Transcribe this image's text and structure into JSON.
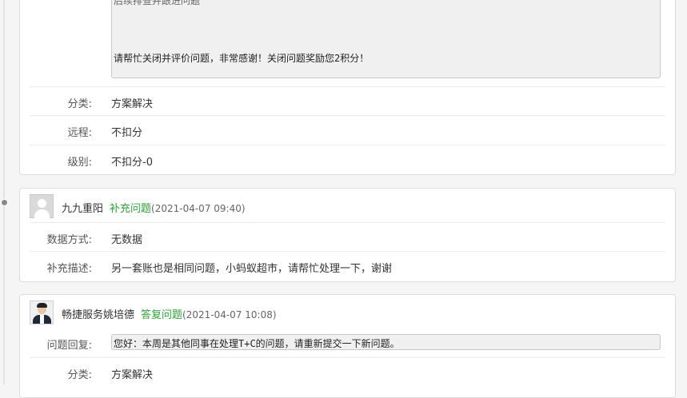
{
  "entry1": {
    "quote_line1": "后续排查并跟进问题",
    "quote_line2": "请帮忙关闭并评价问题，非常感谢！关闭问题奖励您2积分！",
    "fields": [
      {
        "label": "分类:",
        "value": "方案解决"
      },
      {
        "label": "远程:",
        "value": "不扣分"
      },
      {
        "label": "级别:",
        "value": "不扣分-0"
      }
    ]
  },
  "entry2": {
    "user": "九九重阳",
    "action": "补充问题",
    "time": "(2021-04-07 09:40)",
    "fields": [
      {
        "label": "数据方式:",
        "value": "无数据"
      },
      {
        "label": "补充描述:",
        "value": "另一套账也是相同问题，小蚂蚁超市，请帮忙处理一下，谢谢"
      }
    ]
  },
  "entry3": {
    "user": "畅捷服务姚培德",
    "action": "答复问题",
    "time": "(2021-04-07 10:08)",
    "reply_label": "问题回复:",
    "reply_text": "您好：本周是其他同事在处理T+C的问题，请重新提交一下新问题。",
    "fields": [
      {
        "label": "分类:",
        "value": "方案解决"
      }
    ]
  },
  "colors": {
    "action_green": "#2f9e3a",
    "quote_bg": "#f0f0f0"
  }
}
